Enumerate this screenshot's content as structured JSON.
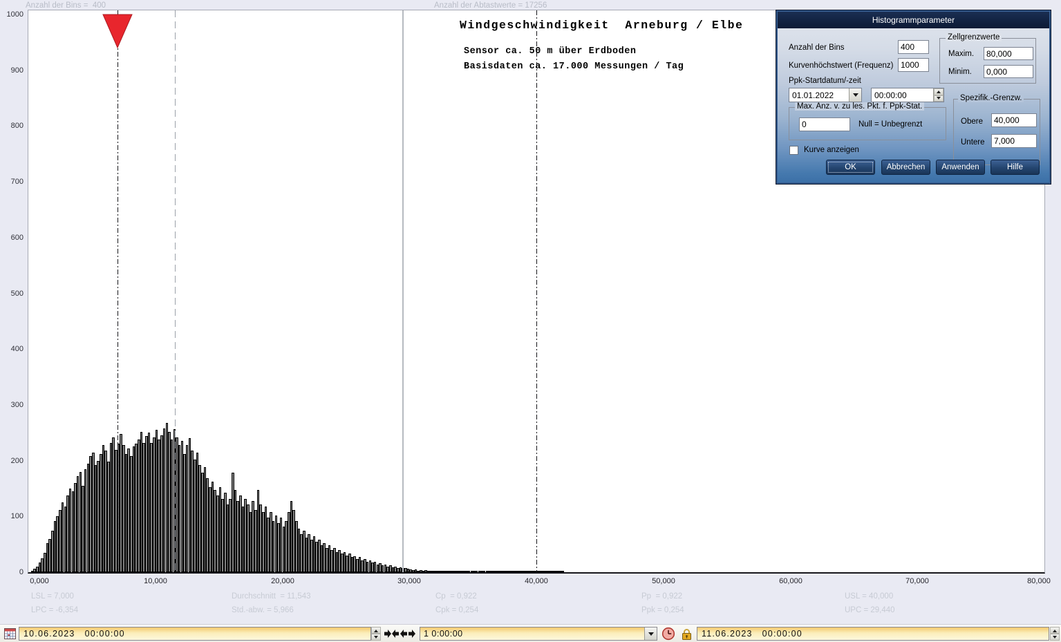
{
  "chart_data": {
    "type": "bar",
    "title": "Windgeschwindigkeit  Arneburg / Elbe",
    "subtitle1": "Sensor ca. 50 m über Erdboden",
    "subtitle2": "Basisdaten ca. 17.000 Messungen / Tag",
    "meta": {
      "bins_label": "Anzahl der Bins =  400",
      "samples_label": "Anzahl der Abtastwerte = 17256"
    },
    "xlabel": "",
    "ylabel": "",
    "xlim": [
      0,
      80000
    ],
    "ylim": [
      0,
      1000
    ],
    "grid": false,
    "bin_start": 0,
    "bin_width": 200,
    "counts": [
      0,
      3,
      6,
      10,
      18,
      25,
      35,
      52,
      60,
      75,
      92,
      100,
      112,
      125,
      118,
      138,
      150,
      145,
      160,
      172,
      180,
      155,
      185,
      195,
      208,
      215,
      192,
      200,
      212,
      228,
      218,
      198,
      232,
      242,
      220,
      230,
      248,
      228,
      212,
      222,
      208,
      225,
      230,
      238,
      252,
      232,
      244,
      250,
      232,
      242,
      255,
      238,
      246,
      258,
      268,
      252,
      238,
      256,
      242,
      228,
      235,
      212,
      228,
      240,
      218,
      202,
      215,
      192,
      178,
      188,
      168,
      152,
      162,
      148,
      138,
      152,
      132,
      142,
      122,
      132,
      178,
      148,
      128,
      138,
      118,
      132,
      122,
      108,
      128,
      112,
      148,
      122,
      108,
      118,
      98,
      108,
      92,
      102,
      88,
      98,
      82,
      92,
      108,
      128,
      112,
      92,
      78,
      68,
      74,
      62,
      68,
      58,
      64,
      54,
      58,
      48,
      52,
      44,
      48,
      40,
      44,
      36,
      40,
      34,
      36,
      30,
      33,
      27,
      29,
      24,
      27,
      21,
      24,
      19,
      21,
      17,
      19,
      14,
      16,
      12,
      14,
      10,
      12,
      9,
      10,
      8,
      9,
      7,
      8,
      6,
      5,
      4,
      5,
      3,
      4,
      3,
      4,
      2,
      3,
      2,
      3,
      2,
      3,
      2,
      2,
      3,
      2,
      2,
      1,
      2,
      3,
      2,
      1,
      2,
      1,
      2,
      1,
      2,
      1,
      1,
      2,
      1,
      1,
      2,
      1,
      1,
      1,
      2,
      1,
      1,
      1,
      1,
      1,
      1,
      1,
      1,
      1,
      1,
      1,
      1,
      2,
      1,
      1,
      3,
      1,
      1,
      2,
      1,
      1,
      2,
      1
    ],
    "x_ticks": [
      {
        "value": 0,
        "label": "0,000"
      },
      {
        "value": 10000,
        "label": "10,000"
      },
      {
        "value": 20000,
        "label": "20,000"
      },
      {
        "value": 30000,
        "label": "30,000"
      },
      {
        "value": 40000,
        "label": "40,000"
      },
      {
        "value": 50000,
        "label": "50,000"
      },
      {
        "value": 60000,
        "label": "60,000"
      },
      {
        "value": 70000,
        "label": "70,000"
      },
      {
        "value": 80000,
        "label": "80,000"
      }
    ],
    "y_ticks": [
      0,
      100,
      200,
      300,
      400,
      500,
      600,
      700,
      800,
      900,
      1000
    ],
    "markers": {
      "lsl": {
        "value": 7000,
        "style": "dashdot-black",
        "arrow_color": "#e8262d"
      },
      "mean": {
        "value": 11543,
        "style": "dashed-gray"
      },
      "upc": {
        "value": 29440,
        "style": "solid-gray"
      },
      "usl": {
        "value": 40000,
        "style": "dashdot-black"
      }
    },
    "bar_color": "#7e7e7e",
    "stats_row1": [
      "LSL = 7,000",
      "Durchschnitt  = 11,543",
      "Cp  = 0,922",
      "Pp  = 0,922",
      "USL = 40,000"
    ],
    "stats_row2": [
      "LPC = -6,354",
      "Std.-abw. = 5,966",
      "Cpk = 0,254",
      "Ppk = 0,254",
      "UPC = 29,440"
    ]
  },
  "dialog": {
    "title": "Histogrammparameter",
    "bins_label": "Anzahl der Bins",
    "bins_value": "400",
    "peak_label": "Kurvenhöchstwert (Frequenz)",
    "peak_value": "1000",
    "ppk_start_label": "Ppk-Startdatum/-zeit",
    "ppk_date": "01.01.2022",
    "ppk_time": "00:00:00",
    "cell_group_label": "Zellgrenzwerte",
    "max_label": "Maxim.",
    "max_value": "80,000",
    "min_label": "Minim.",
    "min_value": "0,000",
    "maxpts_group_label": "Max. Anz. v. zu les. Pkt. f. Ppk-Stat.",
    "maxpts_value": "0",
    "maxpts_hint": "Null = Unbegrenzt",
    "spec_group_label": "Spezifik.-Grenzw.",
    "upper_label": "Obere",
    "upper_value": "40,000",
    "lower_label": "Untere",
    "lower_value": "7,000",
    "curve_checkbox_label": "Kurve anzeigen",
    "buttons": {
      "ok": "OK",
      "cancel": "Abbrechen",
      "apply": "Anwenden",
      "help": "Hilfe"
    }
  },
  "toolbar": {
    "date_from": "10.06.2023   00:00:00",
    "interval": "1 0:00:00",
    "date_to": "11.06.2023   00:00:00"
  }
}
